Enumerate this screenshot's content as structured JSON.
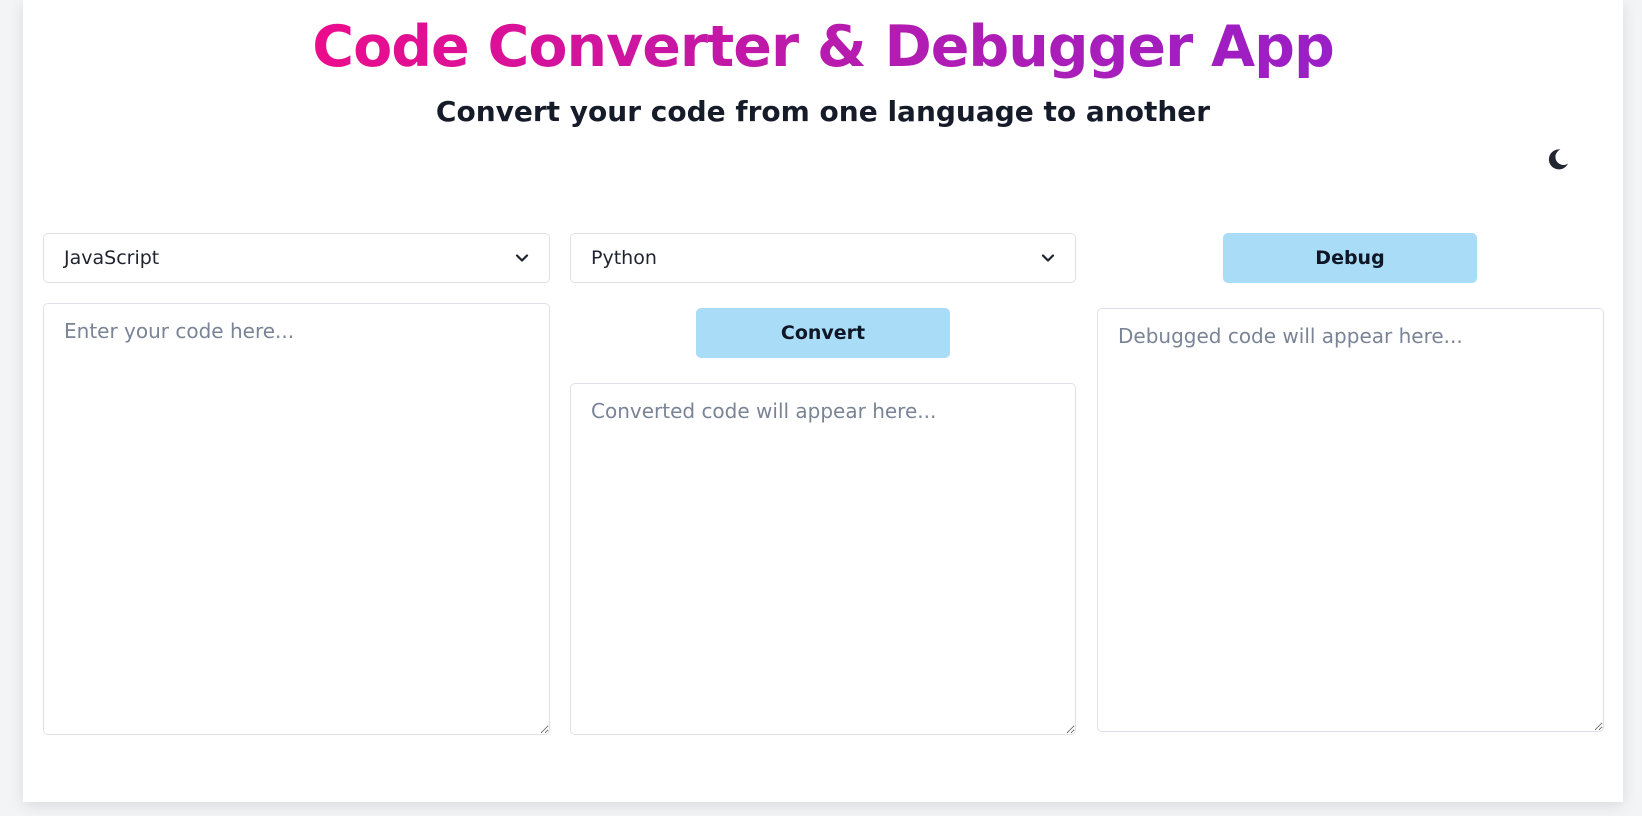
{
  "header": {
    "title": "Code Converter & Debugger App",
    "subtitle": "Convert your code from one language to another"
  },
  "theme_toggle": {
    "icon": "moon-icon"
  },
  "converter": {
    "source_language": "JavaScript",
    "target_language": "Python",
    "input_placeholder": "Enter your code here...",
    "convert_label": "Convert",
    "output_placeholder": "Converted code will appear here..."
  },
  "debugger": {
    "debug_label": "Debug",
    "output_placeholder": "Debugged code will appear here..."
  },
  "colors": {
    "title_gradient_start": "#ec0c8c",
    "title_gradient_end": "#9a1fc6",
    "button_bg": "#a9dcf7",
    "page_bg": "#f3f4f6"
  }
}
